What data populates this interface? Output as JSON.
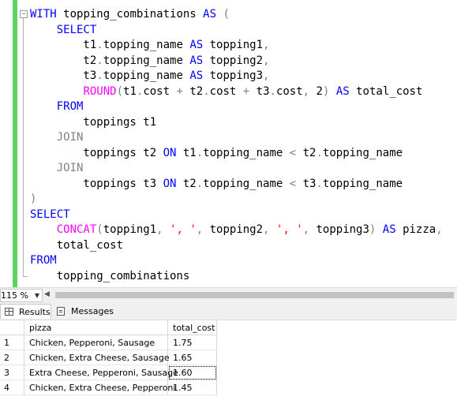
{
  "editor": {
    "lines": [
      [
        {
          "t": "WITH ",
          "c": "kw"
        },
        {
          "t": "topping_combinations ",
          "c": ""
        },
        {
          "t": "AS ",
          "c": "kw"
        },
        {
          "t": "(",
          "c": "gray"
        }
      ],
      [
        {
          "t": "    ",
          "c": ""
        },
        {
          "t": "SELECT",
          "c": "kw"
        }
      ],
      [
        {
          "t": "        t1",
          "c": ""
        },
        {
          "t": ".",
          "c": "gray"
        },
        {
          "t": "topping_name ",
          "c": ""
        },
        {
          "t": "AS ",
          "c": "kw"
        },
        {
          "t": "topping1",
          "c": ""
        },
        {
          "t": ",",
          "c": "gray"
        }
      ],
      [
        {
          "t": "        t2",
          "c": ""
        },
        {
          "t": ".",
          "c": "gray"
        },
        {
          "t": "topping_name ",
          "c": ""
        },
        {
          "t": "AS ",
          "c": "kw"
        },
        {
          "t": "topping2",
          "c": ""
        },
        {
          "t": ",",
          "c": "gray"
        }
      ],
      [
        {
          "t": "        t3",
          "c": ""
        },
        {
          "t": ".",
          "c": "gray"
        },
        {
          "t": "topping_name ",
          "c": ""
        },
        {
          "t": "AS ",
          "c": "kw"
        },
        {
          "t": "topping3",
          "c": ""
        },
        {
          "t": ",",
          "c": "gray"
        }
      ],
      [
        {
          "t": "        ",
          "c": ""
        },
        {
          "t": "ROUND",
          "c": "fn"
        },
        {
          "t": "(",
          "c": "gray"
        },
        {
          "t": "t1",
          "c": ""
        },
        {
          "t": ".",
          "c": "gray"
        },
        {
          "t": "cost ",
          "c": ""
        },
        {
          "t": "+ ",
          "c": "gray"
        },
        {
          "t": "t2",
          "c": ""
        },
        {
          "t": ".",
          "c": "gray"
        },
        {
          "t": "cost ",
          "c": ""
        },
        {
          "t": "+ ",
          "c": "gray"
        },
        {
          "t": "t3",
          "c": ""
        },
        {
          "t": ".",
          "c": "gray"
        },
        {
          "t": "cost",
          "c": ""
        },
        {
          "t": ", ",
          "c": "gray"
        },
        {
          "t": "2",
          "c": ""
        },
        {
          "t": ") ",
          "c": "gray"
        },
        {
          "t": "AS ",
          "c": "kw"
        },
        {
          "t": "total_cost",
          "c": ""
        }
      ],
      [
        {
          "t": "    ",
          "c": ""
        },
        {
          "t": "FROM",
          "c": "kw"
        }
      ],
      [
        {
          "t": "        toppings t1",
          "c": ""
        }
      ],
      [
        {
          "t": "    ",
          "c": ""
        },
        {
          "t": "JOIN",
          "c": "gray"
        }
      ],
      [
        {
          "t": "        toppings t2 ",
          "c": ""
        },
        {
          "t": "ON ",
          "c": "kw"
        },
        {
          "t": "t1",
          "c": ""
        },
        {
          "t": ".",
          "c": "gray"
        },
        {
          "t": "topping_name ",
          "c": ""
        },
        {
          "t": "< ",
          "c": "gray"
        },
        {
          "t": "t2",
          "c": ""
        },
        {
          "t": ".",
          "c": "gray"
        },
        {
          "t": "topping_name",
          "c": ""
        }
      ],
      [
        {
          "t": "    ",
          "c": ""
        },
        {
          "t": "JOIN",
          "c": "gray"
        }
      ],
      [
        {
          "t": "        toppings t3 ",
          "c": ""
        },
        {
          "t": "ON ",
          "c": "kw"
        },
        {
          "t": "t2",
          "c": ""
        },
        {
          "t": ".",
          "c": "gray"
        },
        {
          "t": "topping_name ",
          "c": ""
        },
        {
          "t": "< ",
          "c": "gray"
        },
        {
          "t": "t3",
          "c": ""
        },
        {
          "t": ".",
          "c": "gray"
        },
        {
          "t": "topping_name",
          "c": ""
        }
      ],
      [
        {
          "t": ")",
          "c": "gray"
        }
      ],
      [
        {
          "t": "SELECT",
          "c": "kw"
        }
      ],
      [
        {
          "t": "    ",
          "c": ""
        },
        {
          "t": "CONCAT",
          "c": "fn"
        },
        {
          "t": "(",
          "c": "gray"
        },
        {
          "t": "topping1",
          "c": ""
        },
        {
          "t": ", ",
          "c": "gray"
        },
        {
          "t": "', '",
          "c": "str"
        },
        {
          "t": ", ",
          "c": "gray"
        },
        {
          "t": "topping2",
          "c": ""
        },
        {
          "t": ", ",
          "c": "gray"
        },
        {
          "t": "', '",
          "c": "str"
        },
        {
          "t": ", ",
          "c": "gray"
        },
        {
          "t": "topping3",
          "c": ""
        },
        {
          "t": ") ",
          "c": "gray"
        },
        {
          "t": "AS ",
          "c": "kw"
        },
        {
          "t": "pizza",
          "c": ""
        },
        {
          "t": ",",
          "c": "gray"
        }
      ],
      [
        {
          "t": "    total_cost",
          "c": ""
        }
      ],
      [
        {
          "t": "FROM",
          "c": "kw"
        }
      ],
      [
        {
          "t": "    topping_combinations",
          "c": ""
        }
      ]
    ]
  },
  "status": {
    "zoom": "115 %"
  },
  "results_tabs": {
    "results_label": "Results",
    "messages_label": "Messages"
  },
  "grid": {
    "columns": [
      "pizza",
      "total_cost"
    ],
    "rows": [
      {
        "num": "1",
        "pizza": "Chicken, Pepperoni, Sausage",
        "total_cost": "1.75"
      },
      {
        "num": "2",
        "pizza": "Chicken, Extra Cheese, Sausage",
        "total_cost": "1.65"
      },
      {
        "num": "3",
        "pizza": "Extra Cheese, Pepperoni, Sausage",
        "total_cost": "1.60"
      },
      {
        "num": "4",
        "pizza": "Chicken, Extra Cheese, Pepperoni",
        "total_cost": "1.45"
      }
    ]
  },
  "colors": {
    "keyword": "#0000ff",
    "function": "#ff00ff",
    "operator": "#808080",
    "string": "#ff0000",
    "change_bar": "#5fd35f"
  }
}
